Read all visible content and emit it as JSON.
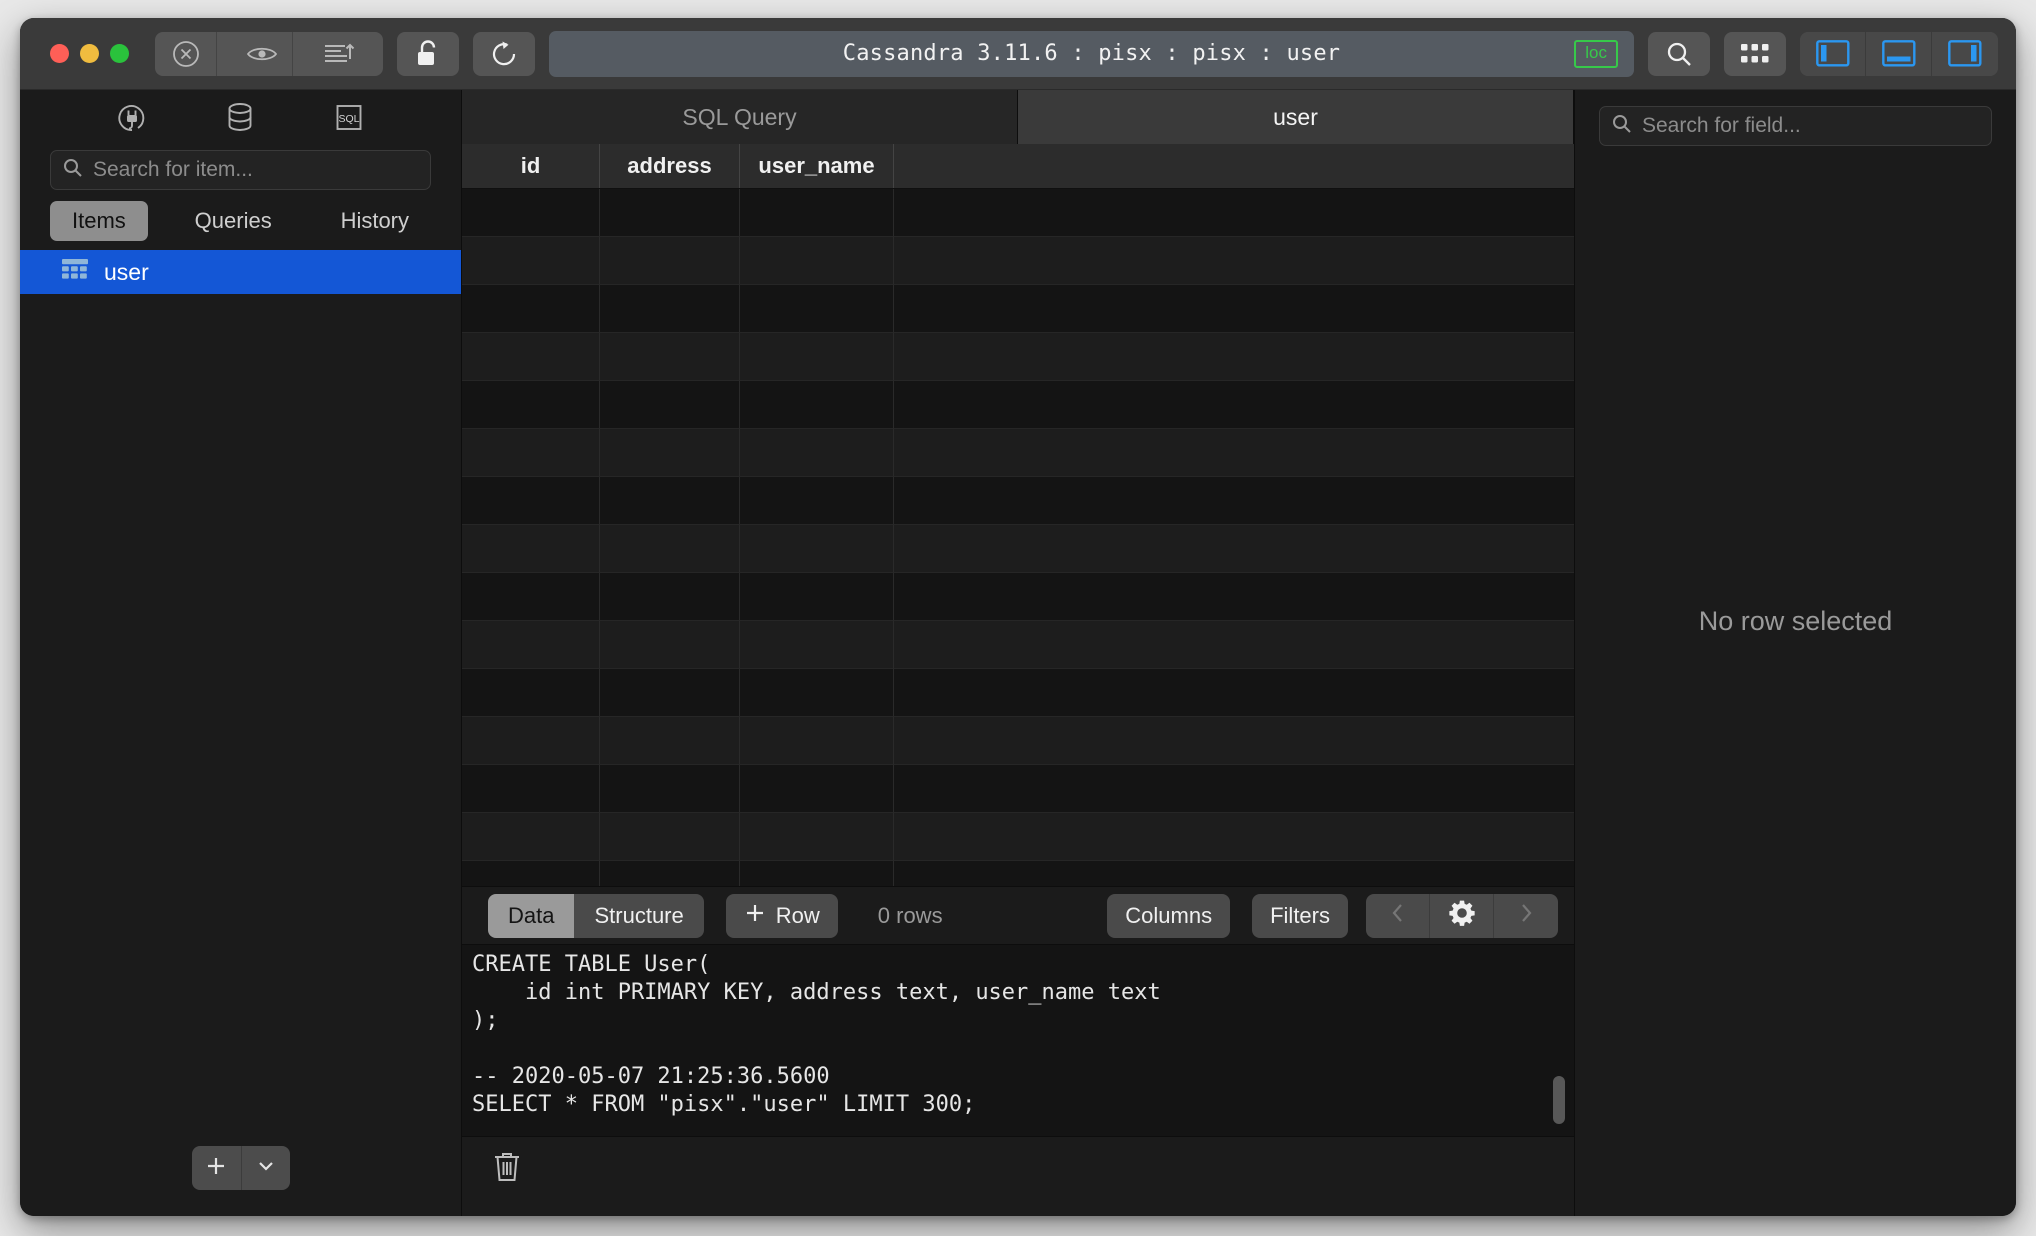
{
  "window": {
    "title": "Cassandra 3.11.6 : pisx : pisx : user",
    "loc_badge": "loc",
    "accent_blue": "#1457d6",
    "badge_green": "#37c94a"
  },
  "titlebar": {
    "traffic": {
      "close": "close-button",
      "minimize": "minimize-button",
      "zoom": "zoom-button"
    },
    "buttons": [
      {
        "name": "stop-button",
        "icon": "circle-x-icon"
      },
      {
        "name": "preview-button",
        "icon": "eye-icon"
      },
      {
        "name": "sort-export-button",
        "icon": "lines-arrow-up-icon"
      },
      {
        "name": "lock-button",
        "icon": "unlocked-padlock-icon"
      },
      {
        "name": "refresh-button",
        "icon": "refresh-icon"
      }
    ],
    "right_buttons": [
      {
        "name": "search-button",
        "icon": "search-icon"
      },
      {
        "name": "apps-grid-button",
        "icon": "grid-dots-icon"
      },
      {
        "name": "toggle-left-panel-button",
        "icon": "panel-left-icon"
      },
      {
        "name": "toggle-bottom-panel-button",
        "icon": "panel-bottom-icon"
      },
      {
        "name": "toggle-right-panel-button",
        "icon": "panel-right-icon"
      }
    ]
  },
  "sidebar": {
    "icons": [
      {
        "name": "connection-icon",
        "label": "connection"
      },
      {
        "name": "database-icon",
        "label": "database"
      },
      {
        "name": "sql-icon",
        "label": "SQL"
      }
    ],
    "search": {
      "value": "",
      "placeholder": "Search for item..."
    },
    "tabs": [
      {
        "label": "Items",
        "active": true
      },
      {
        "label": "Queries",
        "active": false
      },
      {
        "label": "History",
        "active": false
      }
    ],
    "items": [
      {
        "label": "user",
        "icon": "table-grid-icon",
        "selected": true
      }
    ],
    "add_button": "+",
    "add_dropdown": "chevron-down-icon"
  },
  "main": {
    "tabs": [
      {
        "label": "SQL Query",
        "active": false
      },
      {
        "label": "user",
        "active": true
      }
    ],
    "table": {
      "columns": [
        "id",
        "address",
        "user_name"
      ],
      "rows": [],
      "visible_empty_rows": 15
    },
    "gridbar": {
      "view_modes": [
        {
          "label": "Data",
          "active": true
        },
        {
          "label": "Structure",
          "active": false
        }
      ],
      "add_row_label": "Row",
      "add_row_icon": "plus-icon",
      "row_count": "0 rows",
      "columns_label": "Columns",
      "filters_label": "Filters",
      "nav": [
        {
          "name": "prev-page-button",
          "icon": "chevron-left-icon"
        },
        {
          "name": "settings-button",
          "icon": "gear-icon"
        },
        {
          "name": "next-page-button",
          "icon": "chevron-right-icon"
        }
      ]
    },
    "console": {
      "text": "CREATE TABLE User(\n    id int PRIMARY KEY, address text, user_name text\n);\n\n-- 2020-05-07 21:25:36.5600\nSELECT * FROM \"pisx\".\"user\" LIMIT 300;"
    },
    "trash_icon": "trash-icon"
  },
  "rightpanel": {
    "search": {
      "value": "",
      "placeholder": "Search for field..."
    },
    "empty_message": "No row selected"
  }
}
